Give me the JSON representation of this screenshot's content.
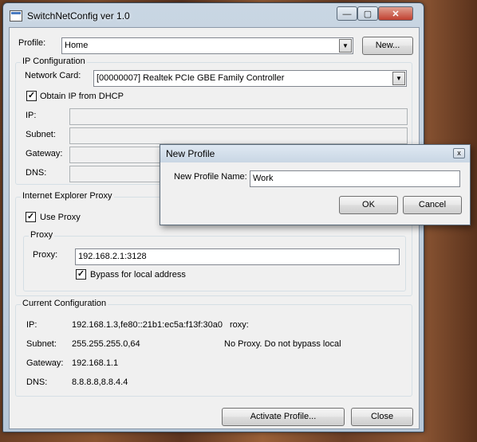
{
  "window": {
    "title": "SwitchNetConfig ver 1.0",
    "minimize": "—",
    "maximize": "▢",
    "close": "✕"
  },
  "profile": {
    "label": "Profile:",
    "selected": "Home",
    "new_button": "New..."
  },
  "ip_config": {
    "group_title": "IP Configuration",
    "network_card_label": "Network Card:",
    "network_card_value": "[00000007] Realtek PCIe GBE Family Controller",
    "dhcp_label": "Obtain IP from DHCP",
    "dhcp_checked": true,
    "ip_label": "IP:",
    "subnet_label": "Subnet:",
    "gateway_label": "Gateway:",
    "dns_label": "DNS:"
  },
  "proxy": {
    "group_title": "Internet Explorer Proxy",
    "use_proxy_label": "Use Proxy",
    "use_proxy_checked": true,
    "inner_group_title": "Proxy",
    "proxy_label": "Proxy:",
    "proxy_value": "192.168.2.1:3128",
    "bypass_label": "Bypass for local address",
    "bypass_checked": true
  },
  "current": {
    "group_title": "Current Configuration",
    "ip_label": "IP:",
    "ip_value": "192.168.1.3,fe80::21b1:ec5a:f13f:30a0",
    "proxy_label_partial": "roxy:",
    "subnet_label": "Subnet:",
    "subnet_value": "255.255.255.0,64",
    "proxy_status": "No Proxy. Do not bypass local",
    "gateway_label": "Gateway:",
    "gateway_value": "192.168.1.1",
    "dns_label": "DNS:",
    "dns_value": "8.8.8.8,8.8.4.4"
  },
  "buttons": {
    "activate": "Activate Profile...",
    "close": "Close"
  },
  "dialog": {
    "title": "New Profile",
    "close": "x",
    "name_label": "New Profile Name:",
    "name_value": "Work",
    "ok": "OK",
    "cancel": "Cancel"
  },
  "icons": {
    "dropdown": "chevron-down-icon",
    "check": "checkmark-icon"
  }
}
